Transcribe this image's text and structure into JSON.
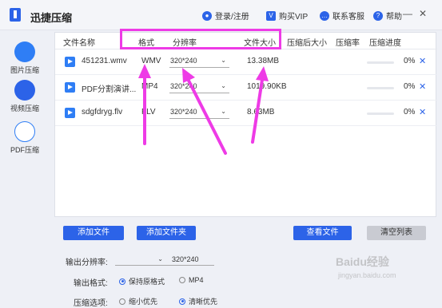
{
  "app": {
    "title": "迅捷压缩"
  },
  "header": {
    "login": "登录/注册",
    "vip": "购买VIP",
    "service": "联系客服",
    "help": "帮助"
  },
  "window": {
    "min": "—",
    "close": "✕"
  },
  "sidebar": {
    "items": [
      {
        "label": "图片压缩",
        "icon": "image-icon"
      },
      {
        "label": "视频压缩",
        "icon": "play-icon"
      },
      {
        "label": "PDF压缩",
        "icon": "pdf-icon"
      }
    ]
  },
  "table": {
    "headers": {
      "name": "文件名称",
      "format": "格式",
      "resolution": "分辨率",
      "size": "文件大小",
      "after_size": "压缩后大小",
      "ratio": "压缩率",
      "progress": "压缩进度"
    },
    "rows": [
      {
        "name": "451231.wmv",
        "format": "WMV",
        "resolution": "320*240",
        "size": "13.38MB",
        "progress": "0%"
      },
      {
        "name": "PDF分割演讲...",
        "format": "MP4",
        "resolution": "320*240",
        "size": "1019.90KB",
        "progress": "0%"
      },
      {
        "name": "sdgfdryg.flv",
        "format": "FLV",
        "resolution": "320*240",
        "size": "8.63MB",
        "progress": "0%"
      }
    ]
  },
  "buttons": {
    "add_file": "添加文件",
    "add_folder": "添加文件夹",
    "view_file": "查看文件",
    "clear_list": "清空列表"
  },
  "settings": {
    "resolution_label": "输出分辨率:",
    "resolution_value": "320*240",
    "format_label": "输出格式:",
    "format_keep": "保持原格式",
    "format_mp4": "MP4",
    "compress_label": "压缩选项:",
    "compress_small": "缩小优先",
    "compress_clear": "清晰优先"
  },
  "colors": {
    "accent": "#2c63e8",
    "highlight": "#ee3be6"
  },
  "watermark": {
    "main": "Baidu经验",
    "sub": "jingyan.baidu.com"
  }
}
